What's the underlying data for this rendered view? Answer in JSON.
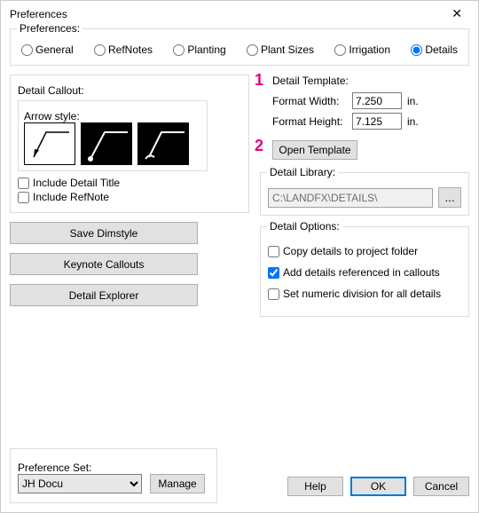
{
  "window": {
    "title": "Preferences",
    "close": "✕"
  },
  "prefs_group": {
    "legend": "Preferences:"
  },
  "tabs": {
    "general": "General",
    "refnotes": "RefNotes",
    "planting": "Planting",
    "plant_sizes": "Plant Sizes",
    "irrigation": "Irrigation",
    "details": "Details"
  },
  "detail_callout": {
    "legend": "Detail Callout:",
    "arrow_legend": "Arrow style:",
    "include_title": "Include Detail Title",
    "include_refnote": "Include RefNote"
  },
  "left_buttons": {
    "save_dimstyle": "Save Dimstyle",
    "keynote": "Keynote Callouts",
    "explorer": "Detail Explorer"
  },
  "template": {
    "legend": "Detail Template:",
    "width_label": "Format Width:",
    "width_value": "7.250",
    "height_label": "Format Height:",
    "height_value": "7.125",
    "unit": "in.",
    "open": "Open Template"
  },
  "library": {
    "legend": "Detail Library:",
    "path": "C:\\LANDFX\\DETAILS\\",
    "browse": "..."
  },
  "options": {
    "legend": "Detail Options:",
    "copy": "Copy details to project folder",
    "add_ref": "Add details referenced in callouts",
    "numeric": "Set numeric division for all details"
  },
  "prefset": {
    "legend": "Preference Set:",
    "value": "JH Docu",
    "manage": "Manage"
  },
  "dlg": {
    "help": "Help",
    "ok": "OK",
    "cancel": "Cancel"
  },
  "annotations": {
    "a1": "1",
    "a2": "2"
  }
}
